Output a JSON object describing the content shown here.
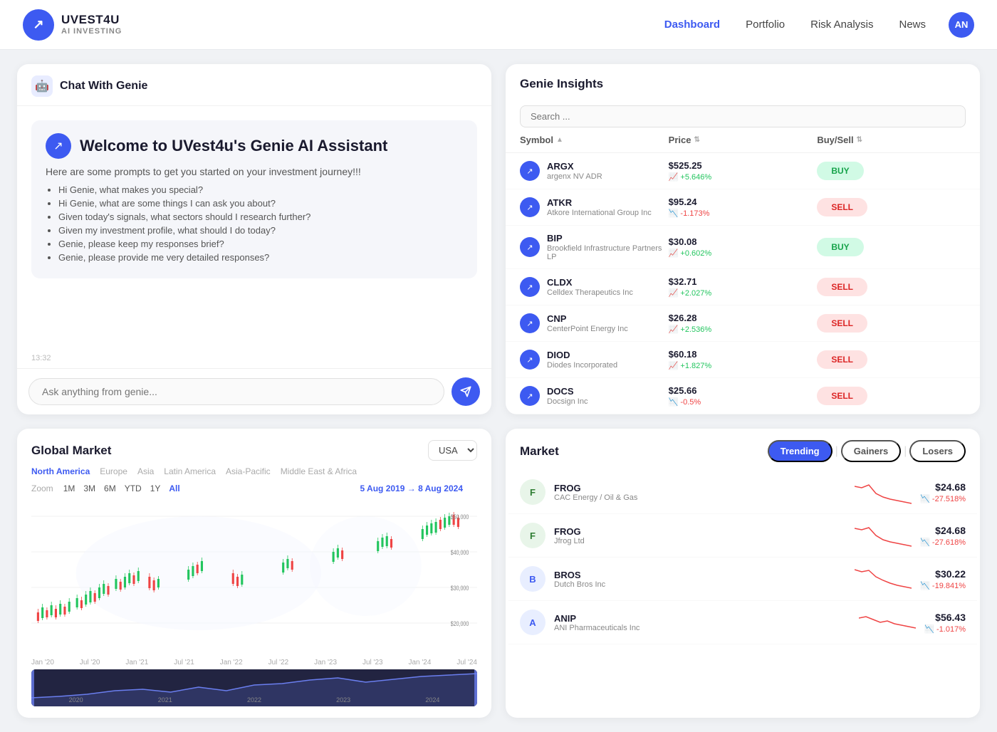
{
  "navbar": {
    "brand": "UVEST4U",
    "sub": "AI INVESTING",
    "logo_icon": "↗",
    "links": [
      {
        "label": "Dashboard",
        "active": true
      },
      {
        "label": "Portfolio",
        "active": false
      },
      {
        "label": "Risk Analysis",
        "active": false
      },
      {
        "label": "News",
        "active": false
      }
    ],
    "user_initials": "AN"
  },
  "chat": {
    "title": "Chat With Genie",
    "welcome": "Welcome to UVest4u's Genie AI Assistant",
    "subtitle": "Here are some prompts to get you started on your investment journey!!!",
    "prompts": [
      "Hi Genie, what makes you special?",
      "Hi Genie, what are some things I can ask you about?",
      "Given today's signals, what sectors should I research further?",
      "Given my investment profile, what should I do today?",
      "Genie, please keep my responses brief?",
      "Genie, please provide me very detailed responses?"
    ],
    "timestamp": "13:32",
    "input_placeholder": "Ask anything from genie..."
  },
  "insights": {
    "title": "Genie Insights",
    "search_placeholder": "Search ...",
    "columns": [
      "Symbol",
      "Price",
      "Buy/Sell"
    ],
    "stocks": [
      {
        "ticker": "ARGX",
        "name": "argenx NV ADR",
        "price": "$525.25",
        "change": "+5.646%",
        "direction": "up",
        "action": "BUY"
      },
      {
        "ticker": "ATKR",
        "name": "Atkore International Group Inc",
        "price": "$95.24",
        "change": "-1.173%",
        "direction": "down",
        "action": "SELL"
      },
      {
        "ticker": "BIP",
        "name": "Brookfield Infrastructure Partners LP",
        "price": "$30.08",
        "change": "+0.602%",
        "direction": "up",
        "action": "BUY"
      },
      {
        "ticker": "CLDX",
        "name": "Celldex Therapeutics Inc",
        "price": "$32.71",
        "change": "+2.027%",
        "direction": "up",
        "action": "SELL"
      },
      {
        "ticker": "CNP",
        "name": "CenterPoint Energy Inc",
        "price": "$26.28",
        "change": "+2.536%",
        "direction": "up",
        "action": "SELL"
      },
      {
        "ticker": "DIOD",
        "name": "Diodes Incorporated",
        "price": "$60.18",
        "change": "+1.827%",
        "direction": "up",
        "action": "SELL"
      },
      {
        "ticker": "DOCS",
        "name": "Docsign Inc",
        "price": "$25.66",
        "change": "-0.5%",
        "direction": "down",
        "action": "SELL"
      }
    ]
  },
  "global_market": {
    "title": "Global Market",
    "region_select": "USA",
    "regions": [
      "North America",
      "Europe",
      "Asia",
      "Latin America",
      "Asia-Pacific",
      "Middle East & Africa"
    ],
    "active_region": "North America",
    "zoom_options": [
      "1M",
      "3M",
      "6M",
      "YTD",
      "1Y",
      "All"
    ],
    "active_zoom": "All",
    "date_range": "5 Aug 2019 → 8 Aug 2024",
    "price_labels": [
      "$50,000",
      "$40,000",
      "$30,000",
      "$20,000"
    ],
    "x_labels": [
      "Jan '20",
      "Jul '20",
      "Jan '21",
      "Jul '21",
      "Jan '22",
      "Jul '22",
      "Jan '23",
      "Jul '23",
      "Jan '24",
      "Jul '24"
    ],
    "mini_labels": [
      "2020",
      "2021",
      "2022",
      "2023",
      "2024"
    ]
  },
  "market": {
    "title": "Market",
    "tabs": [
      "Trending",
      "Gainers",
      "Losers"
    ],
    "active_tab": "Trending",
    "stocks": [
      {
        "ticker": "FROG",
        "name": "CAC Energy / Oil & Gas",
        "price": "$24.68",
        "change": "-27.518%",
        "direction": "down",
        "color": "green"
      },
      {
        "ticker": "FROG",
        "name": "Jfrog Ltd",
        "price": "$24.68",
        "change": "-27.618%",
        "direction": "down",
        "color": "green"
      },
      {
        "ticker": "BROS",
        "name": "Dutch Bros Inc",
        "price": "$30.22",
        "change": "-19.841%",
        "direction": "down",
        "color": "blue"
      },
      {
        "ticker": "ANIP",
        "name": "ANI Pharmaceuticals Inc",
        "price": "$56.43",
        "change": "-1.017%",
        "direction": "down",
        "color": "blue"
      }
    ]
  }
}
